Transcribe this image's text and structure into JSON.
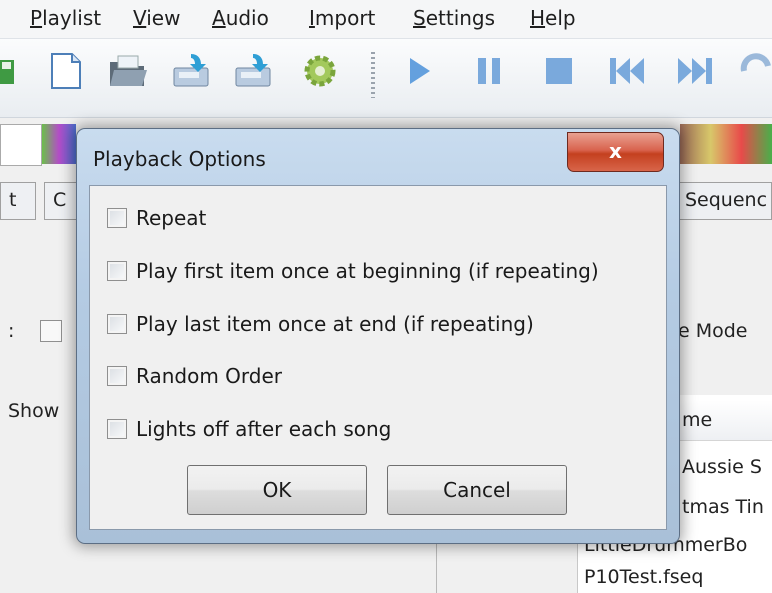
{
  "menubar": {
    "items": [
      "Playlist",
      "View",
      "Audio",
      "Import",
      "Settings",
      "Help"
    ]
  },
  "background": {
    "tab_left_1": "t",
    "tab_left_2": "C",
    "tab_right": "Sequenc",
    "label_colon": ":",
    "mode_label": "e Mode",
    "show_label": "Show",
    "list_header": "me",
    "list_rows": [
      "Aussie S",
      "tmas Tin",
      "LittleDrummerBo",
      "P10Test.fseq"
    ]
  },
  "dialog": {
    "title": "Playback Options",
    "close_label": "x",
    "options": [
      {
        "label": "Repeat",
        "checked": false
      },
      {
        "label": "Play first item once at beginning (if repeating)",
        "checked": false
      },
      {
        "label": "Play last item once at end (if repeating)",
        "checked": false
      },
      {
        "label": "Random Order",
        "checked": false
      },
      {
        "label": "Lights off after each song",
        "checked": false
      }
    ],
    "ok_label": "OK",
    "cancel_label": "Cancel"
  },
  "colors": {
    "close_button": "#c4401f",
    "frame": "#b4cbe3",
    "play_icon": "#4a90d9"
  }
}
